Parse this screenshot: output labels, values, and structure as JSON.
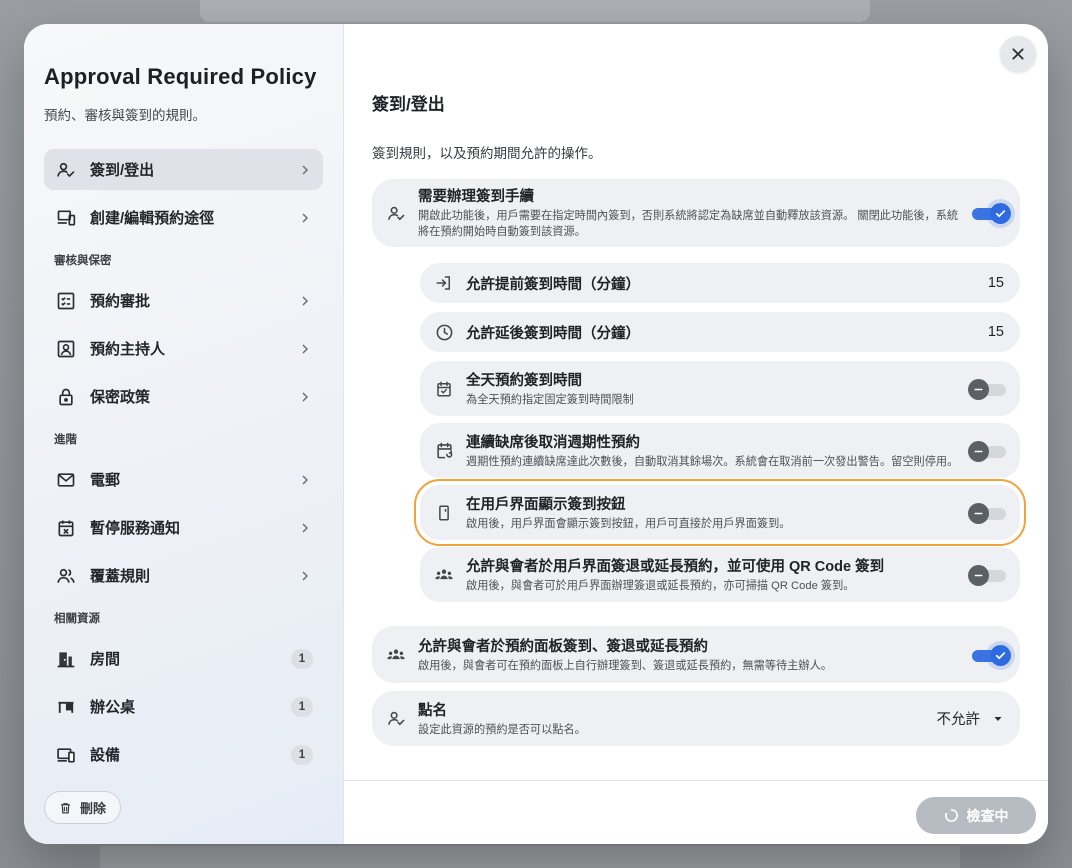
{
  "sidebar": {
    "title": "Approval Required Policy",
    "subtitle": "預約、審核與簽到的規則。",
    "items_top": [
      {
        "label": "簽到/登出",
        "icon": "user-check-icon",
        "active": true
      },
      {
        "label": "創建/編輯預約途徑",
        "icon": "devices-icon",
        "active": false
      }
    ],
    "section_review": "審核與保密",
    "items_review": [
      {
        "label": "預約審批",
        "icon": "approval-list-icon"
      },
      {
        "label": "預約主持人",
        "icon": "host-card-icon"
      },
      {
        "label": "保密政策",
        "icon": "lock-icon"
      }
    ],
    "section_advanced": "進階",
    "items_advanced": [
      {
        "label": "電郵",
        "icon": "mail-icon"
      },
      {
        "label": "暫停服務通知",
        "icon": "calendar-x-icon"
      },
      {
        "label": "覆蓋規則",
        "icon": "users-icon"
      }
    ],
    "section_resources": "相關資源",
    "items_resources": [
      {
        "label": "房間",
        "icon": "door-icon",
        "count": "1"
      },
      {
        "label": "辦公桌",
        "icon": "desk-icon",
        "count": "1"
      },
      {
        "label": "設備",
        "icon": "equipment-icon",
        "count": "1"
      }
    ],
    "delete_label": "刪除"
  },
  "main": {
    "title": "簽到/登出",
    "description": "簽到規則，以及預約期間允許的操作。",
    "require_checkin": {
      "title": "需要辦理簽到手續",
      "desc": "開啟此功能後，用戶需要在指定時間內簽到，否則系統將認定為缺席並自動釋放該資源。 關閉此功能後，系統將在預約開始時自動簽到該資源。",
      "enabled": true
    },
    "sub_rules": [
      {
        "title": "允許提前簽到時間（分鐘）",
        "icon": "login-arrow-icon",
        "value": "15"
      },
      {
        "title": "允許延後簽到時間（分鐘）",
        "icon": "clock-icon",
        "value": "15"
      }
    ],
    "sub_toggles": [
      {
        "title": "全天預約簽到時間",
        "desc": "為全天預約指定固定簽到時間限制",
        "icon": "calendar-check-icon",
        "enabled": false
      },
      {
        "title": "連續缺席後取消週期性預約",
        "desc": "週期性預約連續缺席達此次數後，自動取消其餘場次。系統會在取消前一次發出警告。留空則停用。",
        "icon": "calendar-repeat-icon",
        "enabled": false
      },
      {
        "title": "在用戶界面顯示簽到按鈕",
        "desc": "啟用後，用戶界面會顯示簽到按鈕，用戶可直接於用戶界面簽到。",
        "icon": "phone-icon",
        "enabled": false,
        "highlighted": true
      },
      {
        "title": "允許與會者於用戶界面簽退或延長預約，並可使用 QR Code 簽到",
        "desc": "啟用後，與會者可於用戶界面辦理簽退或延長預約，亦可掃描 QR Code 簽到。",
        "icon": "group-icon",
        "enabled": false
      }
    ],
    "panel_checkin": {
      "title": "允許與會者於預約面板簽到、簽退或延長預約",
      "desc": "啟用後，與會者可在預約面板上自行辦理簽到、簽退或延長預約，無需等待主辦人。",
      "enabled": true
    },
    "roll_call": {
      "title": "點名",
      "desc": "設定此資源的預約是否可以點名。",
      "selected": "不允許"
    },
    "check_button": "檢查中"
  },
  "colors": {
    "accent": "#2f6be0",
    "highlight": "#f2a23a"
  }
}
